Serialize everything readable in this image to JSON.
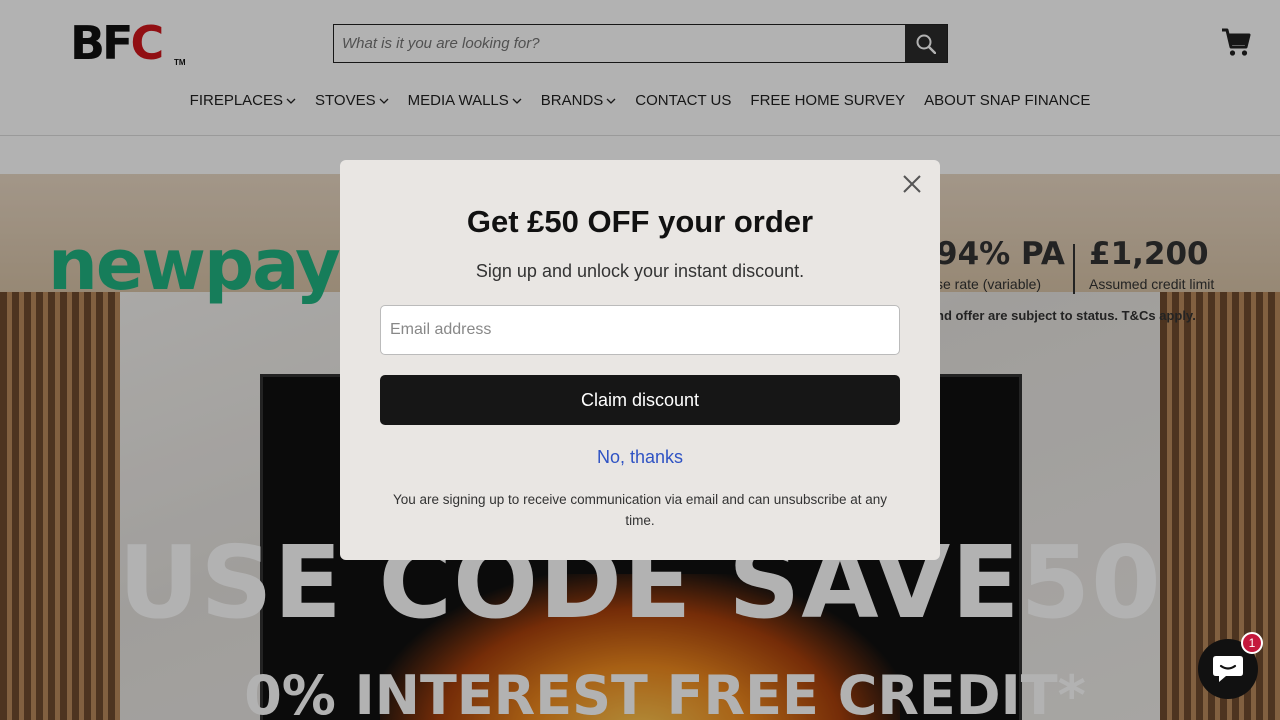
{
  "header": {
    "logo_text": "BFC",
    "logo_tm": "TM",
    "search_placeholder": "What is it you are looking for?",
    "search_icon": "search-icon",
    "cart_icon": "cart-icon"
  },
  "nav": {
    "items": [
      {
        "label": "FIREPLACES",
        "dropdown": true
      },
      {
        "label": "STOVES",
        "dropdown": true
      },
      {
        "label": "MEDIA WALLS",
        "dropdown": true
      },
      {
        "label": "BRANDS",
        "dropdown": true
      },
      {
        "label": "CONTACT US",
        "dropdown": false
      },
      {
        "label": "FREE HOME SURVEY",
        "dropdown": false
      },
      {
        "label": "ABOUT SNAP FINANCE",
        "dropdown": false
      }
    ]
  },
  "hero": {
    "brand": "newpay",
    "rate": "94% PA",
    "rate_sub": "se rate (variable)",
    "limit": "£1,200",
    "limit_sub": "Assumed credit limit",
    "terms": "nd offer are subject to status. T&Cs apply.",
    "code_line": "USE CODE SAVE50",
    "credit_line": "0% INTEREST FREE CREDIT*"
  },
  "modal": {
    "title": "Get £50 OFF your order",
    "subtitle": "Sign up and unlock your instant discount.",
    "email_placeholder": "Email address",
    "claim_label": "Claim discount",
    "decline_label": "No, thanks",
    "legal": "You are signing up to receive communication via email and can unsubscribe at any time.",
    "close_icon": "close-icon"
  },
  "chat": {
    "badge_count": "1",
    "icon": "chat-icon"
  },
  "colors": {
    "logo_red": "#d0161c",
    "newpay_green": "#20b482",
    "link_blue": "#2f53c4",
    "badge_red": "#c4183c"
  }
}
